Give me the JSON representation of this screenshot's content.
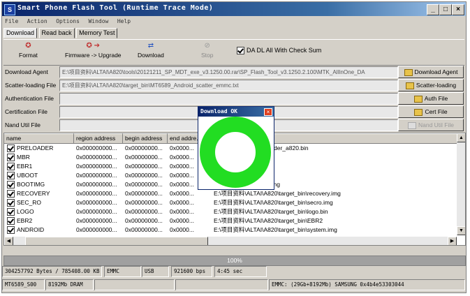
{
  "title_bar": {
    "title": "Smart Phone Flash Tool (Runtime Trace Mode)",
    "minimize": "_",
    "maximize": "□",
    "close": "×"
  },
  "menu": [
    "File",
    "Action",
    "Options",
    "Window",
    "Help"
  ],
  "tabs": [
    "Download",
    "Read back",
    "Memory Test"
  ],
  "toolbar": {
    "format": "Format",
    "firmware_upgrade": "Firmware -> Upgrade",
    "download": "Download",
    "stop": "Stop",
    "da_dl_label": "DA DL All With Check Sum"
  },
  "fields": [
    {
      "label": "Download Agent",
      "value": "E:\\项目资料\\ALTAI\\A820\\tools\\20121211_SP_MDT_exe_v3.1250.00.rar\\SP_Flash_Tool_v3.1250.2.100\\MTK_AllInOne_DA",
      "button": "Download Agent",
      "enabled": true
    },
    {
      "label": "Scatter-loading File",
      "value": "E:\\项目资料\\ALTAI\\A820\\target_bin\\MT6589_Android_scatter_emmc.txt",
      "button": "Scatter-loading",
      "enabled": true
    },
    {
      "label": "Authentication File",
      "value": "",
      "button": "Auth File",
      "enabled": true
    },
    {
      "label": "Certification File",
      "value": "",
      "button": "Cert File",
      "enabled": true
    },
    {
      "label": "Nand Util File",
      "value": "",
      "button": "Nand Util File",
      "enabled": false
    }
  ],
  "table": {
    "columns": [
      "name",
      "region address",
      "begin address",
      "end addre..."
    ],
    "rows": [
      {
        "name": "PRELOADER",
        "region": "0x000000000...",
        "begin": "0x00000000...",
        "end": "0x0000...",
        "path": "A820\\target_bin\\preloader_a820.bin"
      },
      {
        "name": "MBR",
        "region": "0x000000000...",
        "begin": "0x00000000...",
        "end": "0x0000...",
        "path": "A820\\target_bin\\MBR"
      },
      {
        "name": "EBR1",
        "region": "0x000000000...",
        "begin": "0x00000000...",
        "end": "0x0000...",
        "path": "A820\\target_bin\\EBR1"
      },
      {
        "name": "UBOOT",
        "region": "0x000000000...",
        "begin": "0x00000000...",
        "end": "0x0000...",
        "path": "A820\\target_bin\\lk.bin"
      },
      {
        "name": "BOOTIMG",
        "region": "0x000000000...",
        "begin": "0x00000000...",
        "end": "0x0000...",
        "path": "A820\\target_bin\\boot.img"
      },
      {
        "name": "RECOVERY",
        "region": "0x000000000...",
        "begin": "0x00000000...",
        "end": "0x0000...",
        "path": "E:\\项目资料\\ALTAI\\A820\\target_bin\\recovery.img"
      },
      {
        "name": "SEC_RO",
        "region": "0x000000000...",
        "begin": "0x00000000...",
        "end": "0x0000...",
        "path": "E:\\项目资料\\ALTAI\\A820\\target_bin\\secro.img"
      },
      {
        "name": "LOGO",
        "region": "0x000000000...",
        "begin": "0x00000000...",
        "end": "0x0000...",
        "path": "E:\\项目资料\\ALTAI\\A820\\target_bin\\logo.bin"
      },
      {
        "name": "EBR2",
        "region": "0x000000000...",
        "begin": "0x00000000...",
        "end": "0x0000...",
        "path": "E:\\项目资料\\ALTAI\\A820\\target_bin\\EBR2"
      },
      {
        "name": "ANDROID",
        "region": "0x000000000...",
        "begin": "0x00000000...",
        "end": "0x0000...",
        "path": "E:\\项目资料\\ALTAI\\A820\\target_bin\\system.img"
      }
    ]
  },
  "progress": {
    "percent": 100,
    "label": "100%"
  },
  "status_bar_1": [
    "304257792 Bytes / 785408.00 KB",
    "EMMC",
    "USB",
    "921600 bps",
    "4:45 sec"
  ],
  "status_bar_2": [
    "MT6589_S00",
    "8192Mb DRAM",
    "",
    "",
    "EMMC: (29Gb+8192Mb) SAMSUNG 0x4b4e53303044"
  ],
  "dialog": {
    "title": "Download OK",
    "close": "×",
    "ring_color": "#22dd22"
  },
  "colors": {
    "titlebar": "#0a246a",
    "ok_ring": "#22dd22",
    "window_bg": "#d4d0c8"
  }
}
